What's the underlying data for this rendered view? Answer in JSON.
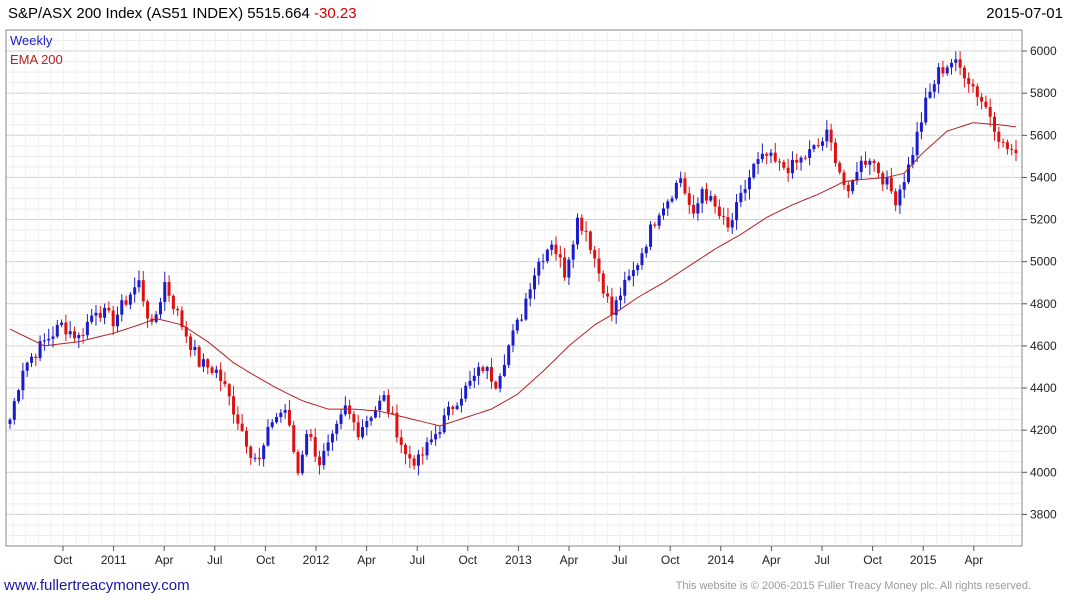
{
  "header": {
    "title": "S&P/ASX 200 Index (AS51 INDEX)",
    "last": "5515.664",
    "change": "-30.23",
    "date": "2015-07-01"
  },
  "legend": {
    "series1": "Weekly",
    "series2": "EMA 200"
  },
  "footer": {
    "url": "www.fullertreacymoney.com",
    "copyright": "This website is © 2006-2015 Fuller Treacy Money plc. All rights reserved."
  },
  "colors": {
    "up": "#1c1ccc",
    "down": "#dd1111",
    "ema": "#b22222",
    "grid": "#dcdcdc"
  },
  "chart_data": {
    "type": "candlestick",
    "frequency": "weekly",
    "ylim": [
      3650,
      6100
    ],
    "y_ticks": [
      3800,
      4000,
      4200,
      4400,
      4600,
      4800,
      5000,
      5200,
      5400,
      5600,
      5800,
      6000
    ],
    "x_tick_labels": [
      "Oct",
      "2011",
      "Apr",
      "Jul",
      "Oct",
      "2012",
      "Apr",
      "Jul",
      "Oct",
      "2013",
      "Apr",
      "Jul",
      "Oct",
      "2014",
      "Apr",
      "Jul",
      "Oct",
      "2015",
      "Apr"
    ],
    "close_anchors": [
      [
        0,
        4250
      ],
      [
        3,
        4500
      ],
      [
        8,
        4620
      ],
      [
        12,
        4700
      ],
      [
        16,
        4640
      ],
      [
        20,
        4780
      ],
      [
        24,
        4720
      ],
      [
        28,
        4850
      ],
      [
        30,
        4900
      ],
      [
        33,
        4680
      ],
      [
        36,
        4900
      ],
      [
        40,
        4700
      ],
      [
        44,
        4520
      ],
      [
        48,
        4480
      ],
      [
        50,
        4400
      ],
      [
        53,
        4250
      ],
      [
        56,
        4100
      ],
      [
        58,
        4050
      ],
      [
        61,
        4250
      ],
      [
        64,
        4300
      ],
      [
        67,
        4000
      ],
      [
        69,
        4200
      ],
      [
        72,
        4050
      ],
      [
        75,
        4150
      ],
      [
        78,
        4300
      ],
      [
        81,
        4200
      ],
      [
        84,
        4280
      ],
      [
        87,
        4350
      ],
      [
        90,
        4200
      ],
      [
        92,
        4080
      ],
      [
        95,
        4050
      ],
      [
        98,
        4150
      ],
      [
        101,
        4250
      ],
      [
        104,
        4350
      ],
      [
        107,
        4420
      ],
      [
        110,
        4500
      ],
      [
        113,
        4430
      ],
      [
        116,
        4600
      ],
      [
        119,
        4750
      ],
      [
        121,
        4900
      ],
      [
        123,
        5000
      ],
      [
        126,
        5100
      ],
      [
        129,
        4950
      ],
      [
        132,
        5200
      ],
      [
        134,
        5150
      ],
      [
        137,
        4950
      ],
      [
        140,
        4750
      ],
      [
        142,
        4850
      ],
      [
        145,
        4950
      ],
      [
        148,
        5100
      ],
      [
        151,
        5250
      ],
      [
        153,
        5300
      ],
      [
        156,
        5400
      ],
      [
        159,
        5200
      ],
      [
        161,
        5350
      ],
      [
        164,
        5250
      ],
      [
        167,
        5150
      ],
      [
        170,
        5300
      ],
      [
        173,
        5450
      ],
      [
        176,
        5500
      ],
      [
        179,
        5450
      ],
      [
        182,
        5450
      ],
      [
        185,
        5500
      ],
      [
        188,
        5550
      ],
      [
        190,
        5600
      ],
      [
        192,
        5500
      ],
      [
        195,
        5300
      ],
      [
        197,
        5450
      ],
      [
        200,
        5500
      ],
      [
        203,
        5400
      ],
      [
        206,
        5300
      ],
      [
        209,
        5450
      ],
      [
        211,
        5600
      ],
      [
        213,
        5750
      ],
      [
        216,
        5900
      ],
      [
        219,
        5950
      ],
      [
        222,
        5900
      ],
      [
        225,
        5800
      ],
      [
        228,
        5700
      ],
      [
        231,
        5550
      ],
      [
        234,
        5516
      ]
    ],
    "ema_anchors": [
      [
        0,
        4680
      ],
      [
        8,
        4600
      ],
      [
        16,
        4620
      ],
      [
        24,
        4660
      ],
      [
        30,
        4700
      ],
      [
        34,
        4730
      ],
      [
        40,
        4700
      ],
      [
        46,
        4620
      ],
      [
        52,
        4520
      ],
      [
        56,
        4470
      ],
      [
        62,
        4400
      ],
      [
        68,
        4340
      ],
      [
        74,
        4300
      ],
      [
        80,
        4300
      ],
      [
        86,
        4290
      ],
      [
        90,
        4270
      ],
      [
        96,
        4240
      ],
      [
        100,
        4220
      ],
      [
        106,
        4260
      ],
      [
        112,
        4300
      ],
      [
        118,
        4370
      ],
      [
        124,
        4480
      ],
      [
        130,
        4600
      ],
      [
        136,
        4700
      ],
      [
        141,
        4760
      ],
      [
        146,
        4830
      ],
      [
        152,
        4900
      ],
      [
        158,
        4980
      ],
      [
        164,
        5060
      ],
      [
        170,
        5130
      ],
      [
        176,
        5210
      ],
      [
        182,
        5270
      ],
      [
        188,
        5320
      ],
      [
        194,
        5380
      ],
      [
        198,
        5390
      ],
      [
        204,
        5400
      ],
      [
        208,
        5420
      ],
      [
        212,
        5510
      ],
      [
        218,
        5620
      ],
      [
        224,
        5660
      ],
      [
        230,
        5650
      ],
      [
        234,
        5640
      ]
    ],
    "last": 5515.664,
    "change": -30.23
  }
}
